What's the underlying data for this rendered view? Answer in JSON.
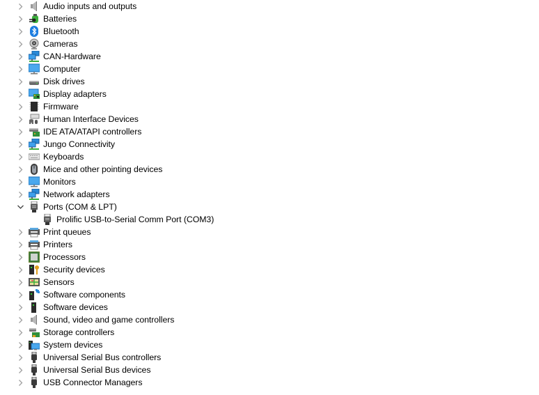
{
  "device_tree": {
    "items": [
      {
        "label": "Audio inputs and outputs",
        "icon": "speaker-icon",
        "expanded": false,
        "level": 0
      },
      {
        "label": "Batteries",
        "icon": "battery-icon",
        "expanded": false,
        "level": 0
      },
      {
        "label": "Bluetooth",
        "icon": "bluetooth-icon",
        "expanded": false,
        "level": 0
      },
      {
        "label": "Cameras",
        "icon": "camera-icon",
        "expanded": false,
        "level": 0
      },
      {
        "label": "CAN-Hardware",
        "icon": "network-icon",
        "expanded": false,
        "level": 0
      },
      {
        "label": "Computer",
        "icon": "monitor-icon",
        "expanded": false,
        "level": 0
      },
      {
        "label": "Disk drives",
        "icon": "disk-drive-icon",
        "expanded": false,
        "level": 0
      },
      {
        "label": "Display adapters",
        "icon": "display-adapter-icon",
        "expanded": false,
        "level": 0
      },
      {
        "label": "Firmware",
        "icon": "chip-icon",
        "expanded": false,
        "level": 0
      },
      {
        "label": "Human Interface Devices",
        "icon": "hid-icon",
        "expanded": false,
        "level": 0
      },
      {
        "label": "IDE ATA/ATAPI controllers",
        "icon": "ide-controller-icon",
        "expanded": false,
        "level": 0
      },
      {
        "label": "Jungo Connectivity",
        "icon": "network-icon",
        "expanded": false,
        "level": 0
      },
      {
        "label": "Keyboards",
        "icon": "keyboard-icon",
        "expanded": false,
        "level": 0
      },
      {
        "label": "Mice and other pointing devices",
        "icon": "mouse-icon",
        "expanded": false,
        "level": 0
      },
      {
        "label": "Monitors",
        "icon": "monitor-icon",
        "expanded": false,
        "level": 0
      },
      {
        "label": "Network adapters",
        "icon": "network-icon",
        "expanded": false,
        "level": 0
      },
      {
        "label": "Ports (COM & LPT)",
        "icon": "port-icon",
        "expanded": true,
        "level": 0
      },
      {
        "label": "Prolific USB-to-Serial Comm Port (COM3)",
        "icon": "port-icon",
        "expanded": null,
        "level": 1
      },
      {
        "label": "Print queues",
        "icon": "printer-icon",
        "expanded": false,
        "level": 0
      },
      {
        "label": "Printers",
        "icon": "printer-icon",
        "expanded": false,
        "level": 0
      },
      {
        "label": "Processors",
        "icon": "processor-icon",
        "expanded": false,
        "level": 0
      },
      {
        "label": "Security devices",
        "icon": "security-device-icon",
        "expanded": false,
        "level": 0
      },
      {
        "label": "Sensors",
        "icon": "sensor-icon",
        "expanded": false,
        "level": 0
      },
      {
        "label": "Software components",
        "icon": "software-component-icon",
        "expanded": false,
        "level": 0
      },
      {
        "label": "Software devices",
        "icon": "software-device-icon",
        "expanded": false,
        "level": 0
      },
      {
        "label": "Sound, video and game controllers",
        "icon": "speaker-icon",
        "expanded": false,
        "level": 0
      },
      {
        "label": "Storage controllers",
        "icon": "storage-controller-icon",
        "expanded": false,
        "level": 0
      },
      {
        "label": "System devices",
        "icon": "system-devices-icon",
        "expanded": false,
        "level": 0
      },
      {
        "label": "Universal Serial Bus controllers",
        "icon": "usb-icon",
        "expanded": false,
        "level": 0
      },
      {
        "label": "Universal Serial Bus devices",
        "icon": "usb-icon",
        "expanded": false,
        "level": 0
      },
      {
        "label": "USB Connector Managers",
        "icon": "usb-icon",
        "expanded": false,
        "level": 0
      }
    ]
  },
  "colors": {
    "background": "#ffffff",
    "text": "#000000",
    "chevron": "#a0a0a0",
    "expanded_chevron": "#404040",
    "icon_blue": "#2b8ad8",
    "icon_green": "#3cae3c"
  }
}
